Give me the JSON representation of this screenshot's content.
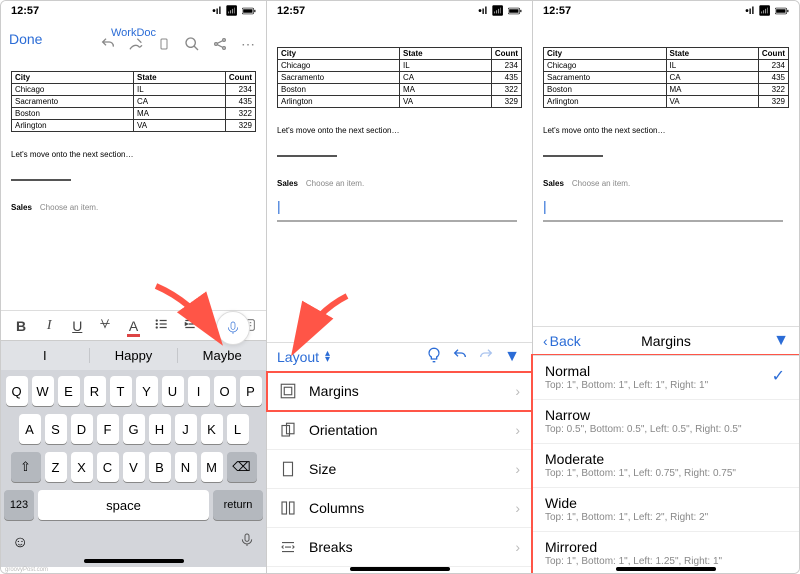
{
  "status": {
    "time": "12:57"
  },
  "header": {
    "done": "Done",
    "title": "WorkDoc"
  },
  "table": {
    "headers": [
      "City",
      "State",
      "Count"
    ],
    "rows": [
      [
        "Chicago",
        "IL",
        "234"
      ],
      [
        "Sacramento",
        "CA",
        "435"
      ],
      [
        "Boston",
        "MA",
        "322"
      ],
      [
        "Arlington",
        "VA",
        "329"
      ]
    ]
  },
  "section_text": "Let's move onto the next section…",
  "sales": {
    "label": "Sales",
    "choose": "Choose an item."
  },
  "toolbar": {
    "bold": "B",
    "italic": "I",
    "under": "U",
    "more": "•••"
  },
  "suggestions": [
    "I",
    "Happy",
    "Maybe"
  ],
  "keyboard": {
    "row1": [
      "Q",
      "W",
      "E",
      "R",
      "T",
      "Y",
      "U",
      "I",
      "O",
      "P"
    ],
    "row2": [
      "A",
      "S",
      "D",
      "F",
      "G",
      "H",
      "J",
      "K",
      "L"
    ],
    "row3": [
      "Z",
      "X",
      "C",
      "V",
      "B",
      "N",
      "M"
    ],
    "shift": "⇧",
    "del": "⌫",
    "num": "123",
    "space": "space",
    "return": "return"
  },
  "layout": {
    "label": "Layout",
    "items": [
      "Margins",
      "Orientation",
      "Size",
      "Columns",
      "Breaks"
    ]
  },
  "margins": {
    "back": "Back",
    "title": "Margins",
    "options": [
      {
        "name": "Normal",
        "sub": "Top: 1\", Bottom: 1\", Left: 1\", Right: 1\"",
        "check": true
      },
      {
        "name": "Narrow",
        "sub": "Top: 0.5\", Bottom: 0.5\", Left: 0.5\", Right: 0.5\""
      },
      {
        "name": "Moderate",
        "sub": "Top: 1\", Bottom: 1\", Left: 0.75\", Right: 0.75\""
      },
      {
        "name": "Wide",
        "sub": "Top: 1\", Bottom: 1\", Left: 2\", Right: 2\""
      },
      {
        "name": "Mirrored",
        "sub": "Top: 1\", Bottom: 1\", Left: 1.25\", Right: 1\""
      }
    ]
  }
}
